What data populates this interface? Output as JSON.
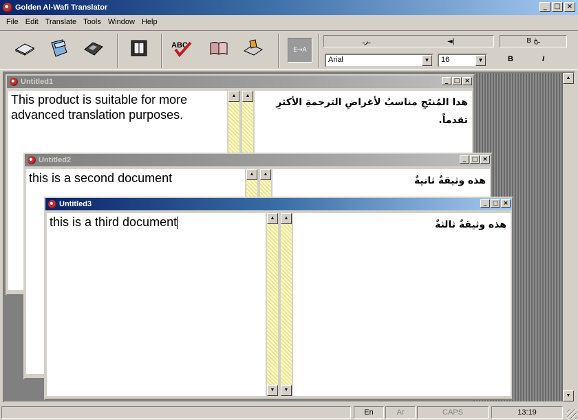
{
  "app": {
    "title": "Golden Al-Wafi Translator",
    "window_controls": [
      "_",
      "□",
      "×"
    ]
  },
  "menu": [
    "File",
    "Edit",
    "Translate",
    "Tools",
    "Window",
    "Help"
  ],
  "toolbar": {
    "buttons": [
      {
        "name": "new",
        "icon": "new-document-icon"
      },
      {
        "name": "open",
        "icon": "open-folder-icon"
      },
      {
        "name": "save",
        "icon": "save-disk-icon"
      },
      {
        "name": "dictionary",
        "icon": "book-icon"
      },
      {
        "name": "spell",
        "icon": "spellcheck-icon",
        "label": "ABC"
      },
      {
        "name": "glossary",
        "icon": "open-book-icon"
      },
      {
        "name": "translate",
        "icon": "translate-icon"
      }
    ],
    "direction_toggle": "E→A",
    "font_name": "Arial",
    "font_size": "16",
    "format_top": [
      "ـرـ",
      "◄|",
      "B ـخ"
    ],
    "bold_label": "B",
    "italic_label": "I"
  },
  "documents": [
    {
      "title": "Untitled1",
      "source_text": "This product is suitable for more advanced translation purposes.",
      "target_text": "هذا المُنتَجِ مناسبُ لأغراضِ الترجمةِ الأكثرِ تقدماً."
    },
    {
      "title": "Untitled2",
      "source_text": "this is a second document",
      "target_text": "هذه وثيقةٌ ثانيةٌ"
    },
    {
      "title": "Untitled3",
      "source_text": "this is a third document",
      "target_text": "هذه وثيقةٌ ثالثةٌ"
    }
  ],
  "status": {
    "lang_en": "En",
    "lang_ar": "Ar",
    "caps": "CAPS",
    "time": "13:19"
  },
  "colors": {
    "active_title": "#0a246a",
    "inactive_title": "#808080",
    "face": "#d4d0c8"
  }
}
